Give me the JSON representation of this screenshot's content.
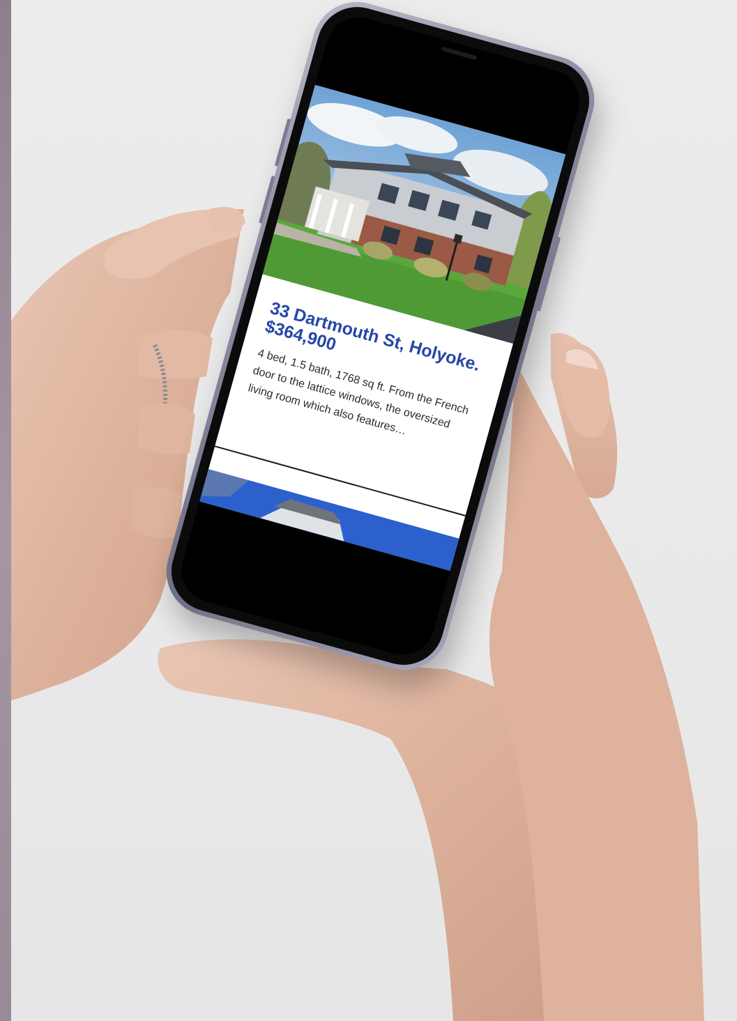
{
  "listing": {
    "title": "33 Dartmouth St, Holyoke. $364,900",
    "description": "4 bed, 1.5 bath, 1768 sq ft. From the French door to the lattice windows, the oversized living room which also features…"
  }
}
